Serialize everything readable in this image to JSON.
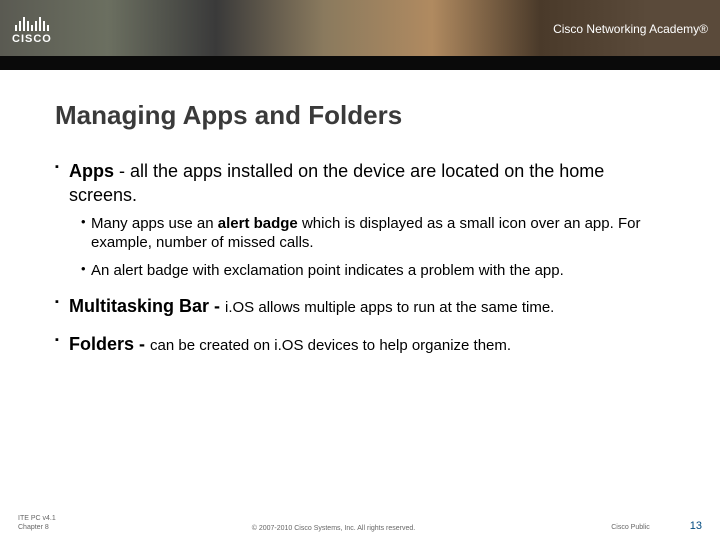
{
  "header": {
    "logo_text": "CISCO",
    "academy": "Cisco Networking Academy®"
  },
  "title": "Managing Apps and Folders",
  "bullets": {
    "apps": {
      "lead": "Apps",
      "rest": " - all the apps installed on the device are located on the home screens.",
      "sub": [
        {
          "pre": "Many apps use an ",
          "bold": "alert badge",
          "post": " which is displayed as a small icon over an app. For example, number of missed calls."
        },
        {
          "pre": "An alert badge with exclamation point indicates a problem with the app.",
          "bold": "",
          "post": ""
        }
      ]
    },
    "multi": {
      "lead": "Multitasking Bar - ",
      "trail": "i.OS allows multiple apps to run at the same time."
    },
    "folders": {
      "lead": "Folders - ",
      "trail": "can be created on i.OS devices to help organize them."
    }
  },
  "footer": {
    "left1": "ITE PC v4.1",
    "left2": "Chapter 8",
    "center": "© 2007-2010 Cisco Systems, Inc. All rights reserved.",
    "right": "Cisco Public",
    "page": "13"
  }
}
